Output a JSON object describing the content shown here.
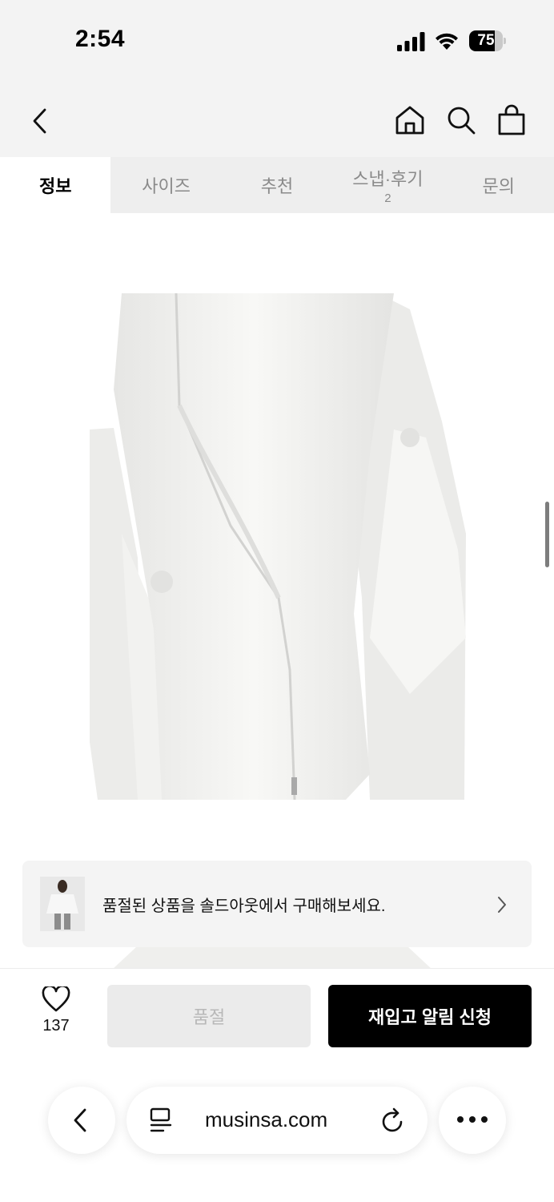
{
  "status_bar": {
    "time": "2:54",
    "battery_percent": 75,
    "battery_label": "75"
  },
  "nav": {
    "back_icon": "chevron-left-icon",
    "home_icon": "home-icon",
    "search_icon": "search-icon",
    "cart_icon": "shopping-bag-icon"
  },
  "tabs": [
    {
      "label": "정보",
      "active": true
    },
    {
      "label": "사이즈"
    },
    {
      "label": "추천"
    },
    {
      "label": "스냅·후기",
      "count": "2"
    },
    {
      "label": "문의"
    }
  ],
  "banner": {
    "text": "품절된 상품을 솔드아웃에서 구매해보세요."
  },
  "actions": {
    "like_count": "137",
    "soldout_label": "품절",
    "restock_label": "재입고 알림 신청"
  },
  "browser": {
    "url": "musinsa.com"
  },
  "colors": {
    "header_bg": "#f3f3f3",
    "primary_button": "#000000",
    "disabled_button": "#ebebeb"
  }
}
